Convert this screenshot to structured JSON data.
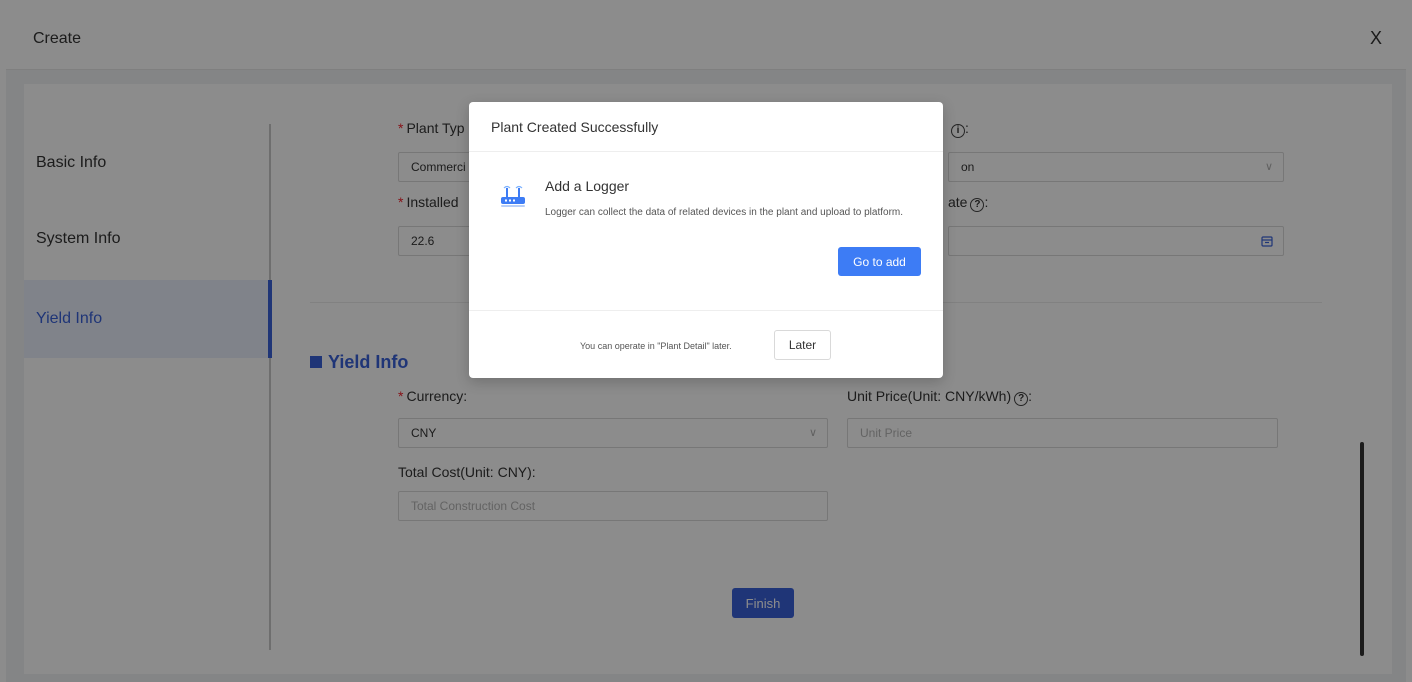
{
  "window": {
    "title": "Create",
    "close_label": "X"
  },
  "steps": [
    {
      "label": "Basic Info"
    },
    {
      "label": "System Info"
    },
    {
      "label": "Yield Info"
    }
  ],
  "system_info": {
    "plant_type_label": "Plant Typ",
    "plant_type_value": "Commerci",
    "installed_label": "Installed",
    "installed_value": "22.6",
    "right_field1_label": ":",
    "right_field1_value": "on",
    "right_field2_label": "ate",
    "right_field2_suffix": ":"
  },
  "yield_info": {
    "section_title": "Yield Info",
    "currency_label": "Currency:",
    "currency_value": "CNY",
    "unit_price_label": "Unit Price(Unit: CNY/kWh)",
    "unit_price_suffix": ":",
    "unit_price_placeholder": "Unit Price",
    "total_cost_label": "Total Cost(Unit: CNY):",
    "total_cost_placeholder": "Total Construction Cost",
    "finish_label": "Finish"
  },
  "icons": {
    "info": "i",
    "help": "?",
    "chevron": "∨"
  },
  "modal": {
    "title": "Plant Created Successfully",
    "logger_title": "Add a Logger",
    "logger_desc": "Logger can collect the data of related devices in the plant and upload to platform.",
    "goto_label": "Go to add",
    "footer_text": "You can operate in \"Plant Detail\" later.",
    "later_label": "Later"
  },
  "colors": {
    "primary": "#3a62d9",
    "modal_button": "#3d7cf5",
    "required": "#f5222d"
  }
}
